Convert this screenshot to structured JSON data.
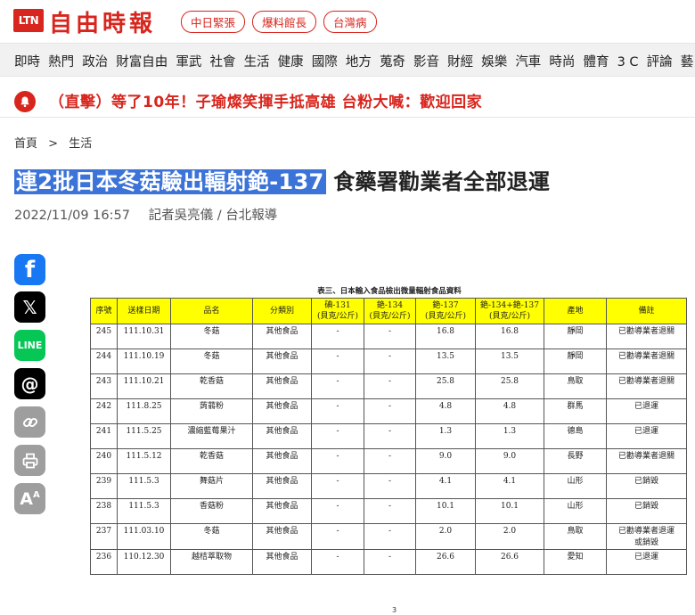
{
  "header": {
    "logo_abbr": "LTN",
    "logo_name": "自由時報",
    "hot_links": [
      "中日緊張",
      "爆料館長",
      "台灣病"
    ]
  },
  "nav": {
    "items": [
      "即時",
      "熱門",
      "政治",
      "財富自由",
      "軍武",
      "社會",
      "生活",
      "健康",
      "國際",
      "地方",
      "蒐奇",
      "影音",
      "財經",
      "娛樂",
      "汽車",
      "時尚",
      "體育",
      "3 C",
      "評論",
      "藝"
    ]
  },
  "breaking": {
    "text": "（直擊）等了10年！子瑜燦笑揮手抵高雄 台粉大喊：歡迎回家"
  },
  "breadcrumb": {
    "home": "首頁",
    "sep": ">",
    "category": "生活"
  },
  "article": {
    "title_highlight": "連2批日本冬菇驗出輻射銫-137",
    "title_rest": " 食藥署勸業者全部退運",
    "date": "2022/11/09 16:57",
    "byline": "記者吳亮儀 / 台北報導"
  },
  "share": {
    "facebook": "f",
    "x": "𝕏",
    "line": "LINE",
    "threads": "@",
    "font": "A"
  },
  "document": {
    "title": "表三、日本輸入食品檢出微量輻射食品資料",
    "headers": [
      "序號",
      "送樣日期",
      "品名",
      "分類別",
      "碘-131\n(貝克/公斤)",
      "銫-134\n(貝克/公斤)",
      "銫-137\n(貝克/公斤)",
      "銫-134+銫-137\n(貝克/公斤)",
      "產地",
      "備註"
    ],
    "rows": [
      [
        "245",
        "111.10.31",
        "冬菇",
        "其他食品",
        "-",
        "-",
        "16.8",
        "16.8",
        "靜岡",
        "已勸導業者退關"
      ],
      [
        "244",
        "111.10.19",
        "冬菇",
        "其他食品",
        "-",
        "-",
        "13.5",
        "13.5",
        "靜岡",
        "已勸導業者退關"
      ],
      [
        "243",
        "111.10.21",
        "乾香菇",
        "其他食品",
        "-",
        "-",
        "25.8",
        "25.8",
        "鳥取",
        "已勸導業者退關"
      ],
      [
        "242",
        "111.8.25",
        "蒟蒻粉",
        "其他食品",
        "-",
        "-",
        "4.8",
        "4.8",
        "群馬",
        "已退運"
      ],
      [
        "241",
        "111.5.25",
        "濃縮藍莓果汁",
        "其他食品",
        "-",
        "-",
        "1.3",
        "1.3",
        "德島",
        "已退運"
      ],
      [
        "240",
        "111.5.12",
        "乾香菇",
        "其他食品",
        "-",
        "-",
        "9.0",
        "9.0",
        "長野",
        "已勸導業者退關"
      ],
      [
        "239",
        "111.5.3",
        "舞菇片",
        "其他食品",
        "-",
        "-",
        "4.1",
        "4.1",
        "山形",
        "已銷毀"
      ],
      [
        "238",
        "111.5.3",
        "香菇粉",
        "其他食品",
        "-",
        "-",
        "10.1",
        "10.1",
        "山形",
        "已銷毀"
      ],
      [
        "237",
        "111.03.10",
        "冬菇",
        "其他食品",
        "-",
        "-",
        "2.0",
        "2.0",
        "鳥取",
        "已勸導業者退運\n或銷毀"
      ],
      [
        "236",
        "110.12.30",
        "越桔萃取物",
        "其他食品",
        "-",
        "-",
        "26.6",
        "26.6",
        "愛知",
        "已退運"
      ]
    ],
    "page_number": "3"
  },
  "colors": {
    "brand_red": "#d8251d",
    "highlight_blue": "#3b73d8",
    "table_header_yellow": "#ffff00",
    "facebook": "#1877f2",
    "x": "#000000",
    "line": "#06c755",
    "threads": "#000000",
    "grey_button": "#9e9e9e"
  }
}
